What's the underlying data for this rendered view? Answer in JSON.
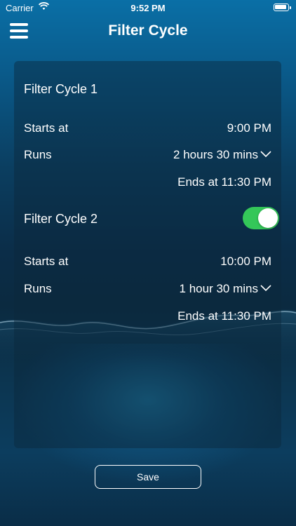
{
  "status_bar": {
    "carrier": "Carrier",
    "time": "9:52 PM"
  },
  "header": {
    "title": "Filter Cycle",
    "menu_icon": "hamburger-menu-icon"
  },
  "cycle1": {
    "title": "Filter Cycle 1",
    "starts_label": "Starts at",
    "starts_value": "9:00 PM",
    "runs_label": "Runs",
    "runs_value": "2 hours 30 mins",
    "ends_text": "Ends at 11:30 PM"
  },
  "cycle2": {
    "title": "Filter Cycle 2",
    "enabled": true,
    "starts_label": "Starts at",
    "starts_value": "10:00 PM",
    "runs_label": "Runs",
    "runs_value": "1 hour 30 mins",
    "ends_text": "Ends at 11:30 PM"
  },
  "save_label": "Save",
  "colors": {
    "toggle_on": "#34c759",
    "accent_text": "#ffffff"
  }
}
